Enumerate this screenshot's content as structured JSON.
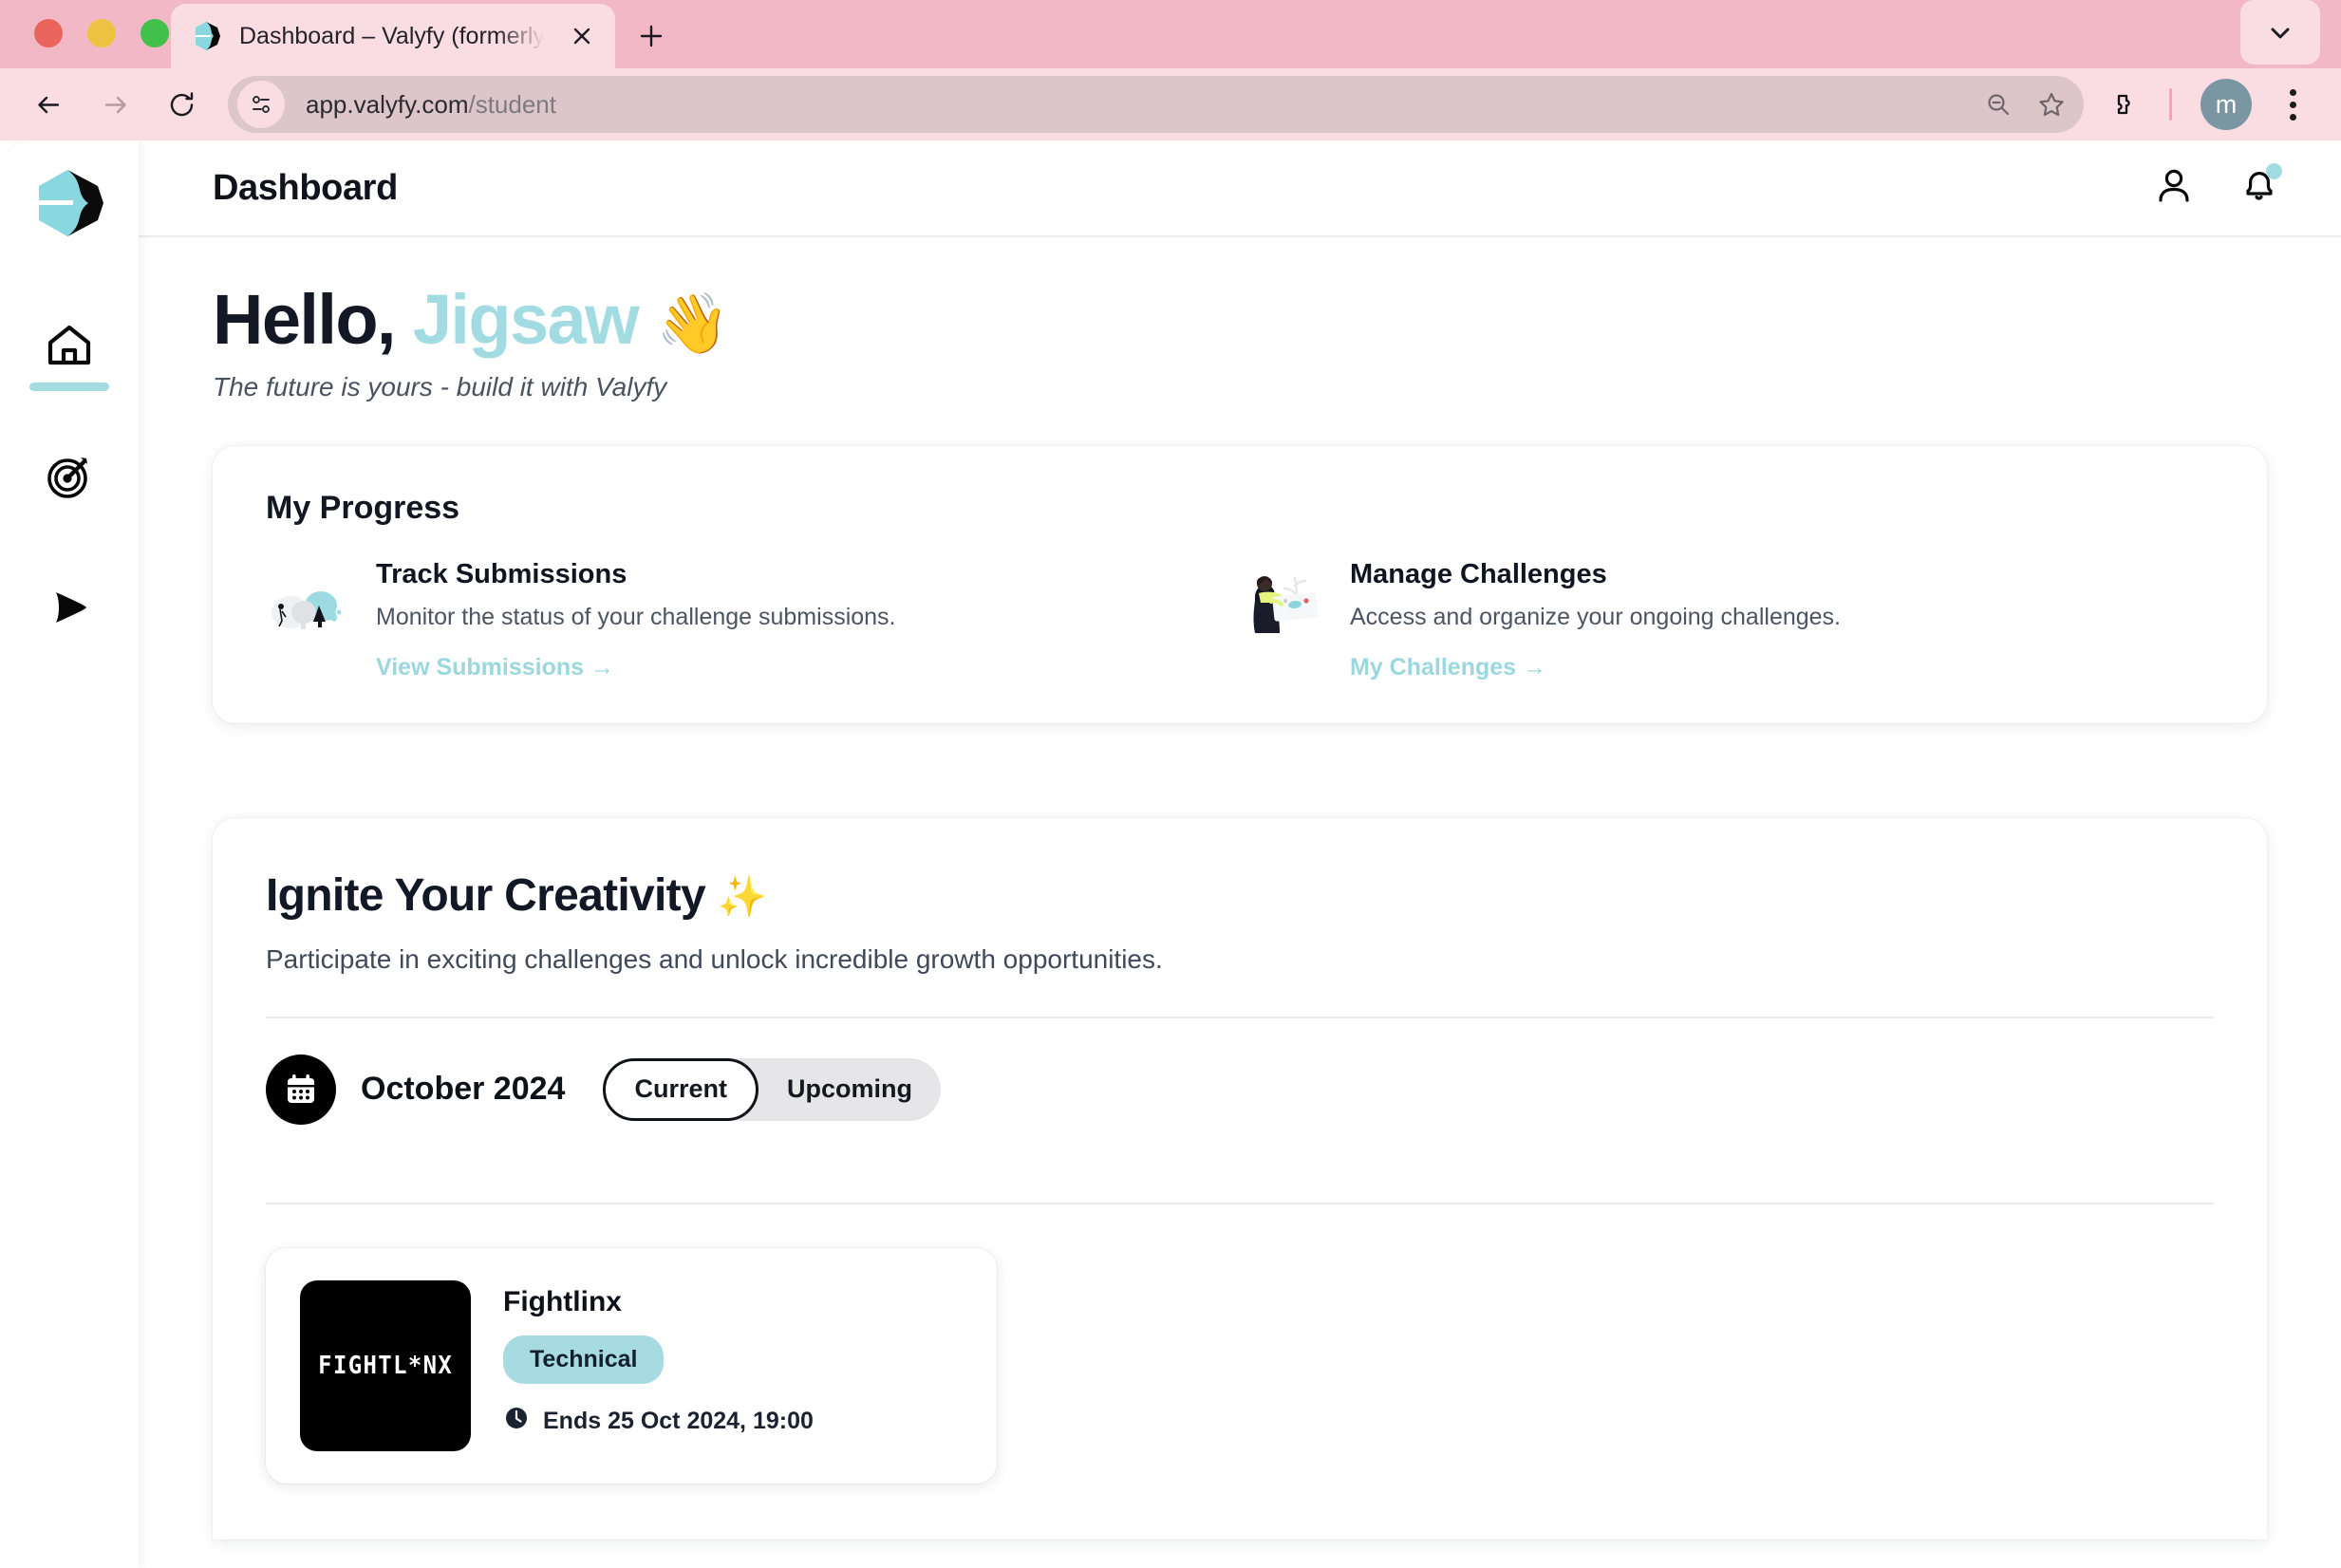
{
  "browser": {
    "tab": {
      "title": "Dashboard – Valyfy (formerly",
      "favicon_name": "valyfy-favicon",
      "close_label": "×"
    },
    "new_tab_label": "+",
    "tab_list_chevron": "chevron-down",
    "nav": {
      "back": "back-arrow",
      "forward": "forward-arrow",
      "reload": "reload-arrow"
    },
    "omnibox": {
      "site_info_icon": "site-settings-icon",
      "url_host": "app.valyfy.com",
      "url_path": "/student",
      "zoom_icon": "zoom-out-icon",
      "bookmark_icon": "star-icon"
    },
    "extensions_icon": "puzzle-icon",
    "profile_initial": "m",
    "menu_icon": "kebab-menu-icon",
    "traffic_lights": [
      "close",
      "minimize",
      "maximize"
    ],
    "colors": {
      "chrome_top": "#f2b8c6",
      "toolbar": "#fadce3",
      "omnibox": "#dcc6ca",
      "avatar": "#7b96a3"
    }
  },
  "sidebar": {
    "logo_name": "valyfy-logo",
    "items": [
      {
        "name": "home",
        "icon": "home-icon",
        "active": true
      },
      {
        "name": "challenges",
        "icon": "target-icon",
        "active": false
      },
      {
        "name": "submissions",
        "icon": "play-arrow-icon",
        "active": false
      }
    ],
    "active_indicator_color": "#a2dce2"
  },
  "header": {
    "title": "Dashboard",
    "profile_icon": "user-icon",
    "notifications_icon": "bell-icon",
    "notification_dot": true
  },
  "greeting": {
    "hello": "Hello,",
    "name": "Jigsaw",
    "wave": "👋",
    "tagline": "The future is yours - build it with Valyfy",
    "name_color": "#a2dce2"
  },
  "progress": {
    "title": "My Progress",
    "cards": [
      {
        "illustration": "person-with-trees-illustration",
        "title": "Track Submissions",
        "description": "Monitor the status of your challenge submissions.",
        "link": "View Submissions →"
      },
      {
        "illustration": "person-with-board-illustration",
        "title": "Manage Challenges",
        "description": "Access and organize your ongoing challenges.",
        "link": "My Challenges →"
      }
    ],
    "link_color": "#9bd7de"
  },
  "ignite": {
    "title": "Ignite Your Creativity",
    "title_emoji": "✨",
    "subtitle": "Participate in exciting challenges and unlock incredible growth opportunities.",
    "calendar_icon": "calendar-icon",
    "month": "October 2024",
    "filter": {
      "options": [
        "Current",
        "Upcoming"
      ],
      "selected": "Current"
    },
    "challenges": [
      {
        "thumb_text": "FIGHTL*NX",
        "thumb_name": "fightlinx-logo-thumbnail",
        "title": "Fightlinx",
        "tag": "Technical",
        "tag_color": "#a7dbe2",
        "clock_icon": "clock-icon",
        "ends": "Ends 25 Oct 2024, 19:00"
      }
    ]
  }
}
